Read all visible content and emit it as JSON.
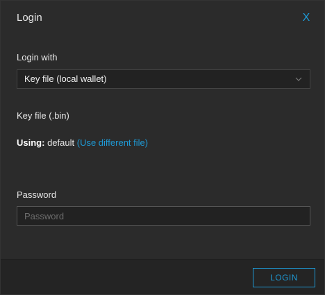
{
  "dialog": {
    "title": "Login",
    "close_glyph": "X"
  },
  "form": {
    "login_with_label": "Login with",
    "login_method_value": "Key file (local wallet)",
    "key_file_label": "Key file (.bin)",
    "using_label": "Using:",
    "using_value": "default",
    "use_different_file_link": "(Use different file)",
    "password_label": "Password",
    "password_placeholder": "Password"
  },
  "footer": {
    "login_button": "LOGIN"
  },
  "colors": {
    "accent": "#1e9ad6",
    "background": "#2b2b2b",
    "footer_background": "#242424"
  },
  "icons": {
    "close": "close-icon",
    "dropdown": "chevron-down-icon"
  }
}
